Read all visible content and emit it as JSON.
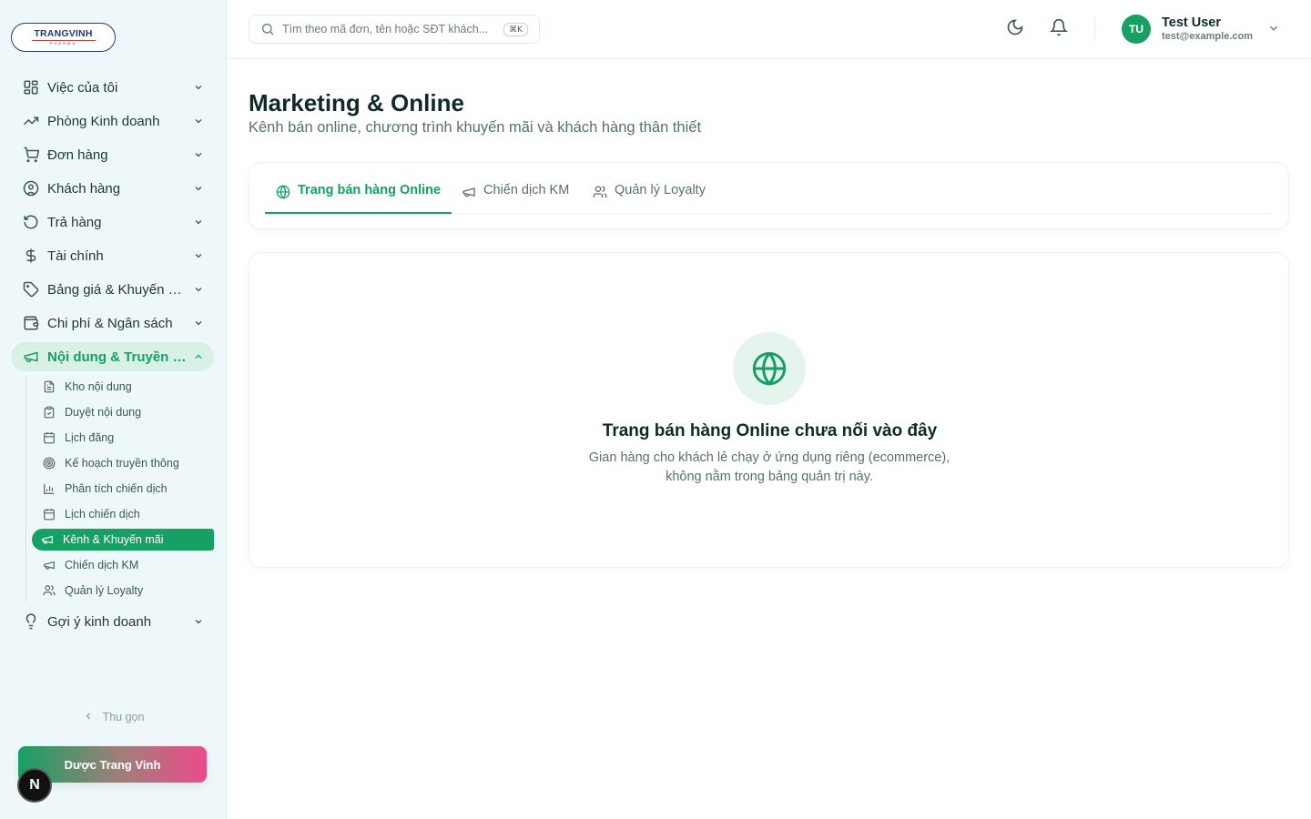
{
  "brand": {
    "logo_name": "TRANGVINH",
    "logo_sub": "PHARMA"
  },
  "sidebar": {
    "items": [
      {
        "label": "Việc của tôi",
        "icon": "grid-icon"
      },
      {
        "label": "Phòng Kinh doanh",
        "icon": "trending-up-icon"
      },
      {
        "label": "Đơn hàng",
        "icon": "cart-icon"
      },
      {
        "label": "Khách hàng",
        "icon": "user-circle-icon"
      },
      {
        "label": "Trả hàng",
        "icon": "rotate-ccw-icon"
      },
      {
        "label": "Tài chính",
        "icon": "dollar-icon"
      },
      {
        "label": "Bảng giá & Khuyến mãi",
        "icon": "tag-icon"
      },
      {
        "label": "Chi phí & Ngân sách",
        "icon": "wallet-icon"
      },
      {
        "label": "Nội dung & Truyền thông",
        "icon": "megaphone-icon"
      }
    ],
    "subitems": [
      {
        "label": "Kho nội dung",
        "icon": "file-text-icon"
      },
      {
        "label": "Duyệt nội dung",
        "icon": "clipboard-check-icon"
      },
      {
        "label": "Lịch đăng",
        "icon": "calendar-icon"
      },
      {
        "label": "Kế hoạch truyền thông",
        "icon": "target-icon"
      },
      {
        "label": "Phân tích chiến dịch",
        "icon": "bar-chart-icon"
      },
      {
        "label": "Lịch chiến dịch",
        "icon": "calendar-icon"
      },
      {
        "label": "Kênh & Khuyến mãi",
        "icon": "megaphone-icon"
      },
      {
        "label": "Chiến dịch KM",
        "icon": "megaphone-icon"
      },
      {
        "label": "Quản lý Loyalty",
        "icon": "users-icon"
      }
    ],
    "last_item": {
      "label": "Gợi ý kinh doanh",
      "icon": "lightbulb-icon"
    },
    "collapse_label": "Thu gọn",
    "company_label": "Dược Trang Vinh",
    "badge_letter": "N"
  },
  "topbar": {
    "search_placeholder": "Tìm theo mã đơn, tên hoặc SĐT khách...",
    "shortcut": "⌘K",
    "user": {
      "initials": "TU",
      "name": "Test User",
      "email": "test@example.com"
    }
  },
  "main": {
    "title": "Marketing & Online",
    "subtitle": "Kênh bán online, chương trình khuyến mãi và khách hàng thân thiết",
    "tabs": [
      {
        "label": "Trang bán hàng Online",
        "icon": "globe-icon",
        "active": true
      },
      {
        "label": "Chiến dịch KM",
        "icon": "megaphone-icon",
        "active": false
      },
      {
        "label": "Quản lý Loyalty",
        "icon": "users-icon",
        "active": false
      }
    ],
    "empty": {
      "title": "Trang bán hàng Online chưa nối vào đây",
      "description": "Gian hàng cho khách lẻ chạy ở ứng dụng riêng (ecommerce), không nằm trong bảng quản trị này."
    }
  },
  "colors": {
    "accent": "#16a063",
    "sidebar_bg": "#eef8fb",
    "active_bg": "#d9f0e7",
    "text": "#0f2a2a",
    "muted": "#5b6f6f"
  }
}
